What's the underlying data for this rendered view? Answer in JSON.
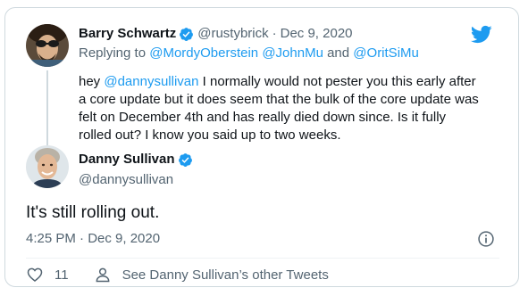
{
  "reply_tweet": {
    "author_name": "Barry Schwartz",
    "author_handle": "@rustybrick",
    "separator": "·",
    "date": "Dec 9, 2020",
    "replying_prefix": "Replying to ",
    "replying_to": "@MordyOberstein @JohnMu",
    "replying_and": " and ",
    "replying_last": "@OritSiMu",
    "text_before_mention": "hey ",
    "mention": "@dannysullivan",
    "text_after_mention": " I normally would not pester you this early after a core update but it does seem that the bulk of the core update was felt on December 4th and has really died down since.  Is it fully rolled out? I know you said up to two weeks."
  },
  "main_tweet": {
    "author_name": "Danny Sullivan",
    "author_handle": "@dannysullivan",
    "text": "It's still rolling out.",
    "timestamp": "4:25 PM · Dec 9, 2020"
  },
  "actions": {
    "like_count": "11",
    "profile_link": "See Danny Sullivan’s other Tweets"
  },
  "icons": {
    "verified": "verified-badge-icon",
    "twitter": "twitter-bird-icon",
    "info": "info-icon",
    "heart": "heart-icon",
    "person": "person-icon"
  },
  "colors": {
    "accent": "#1d9bf0",
    "text": "#0f1419",
    "muted": "#536471",
    "border": "#cfd9de"
  }
}
